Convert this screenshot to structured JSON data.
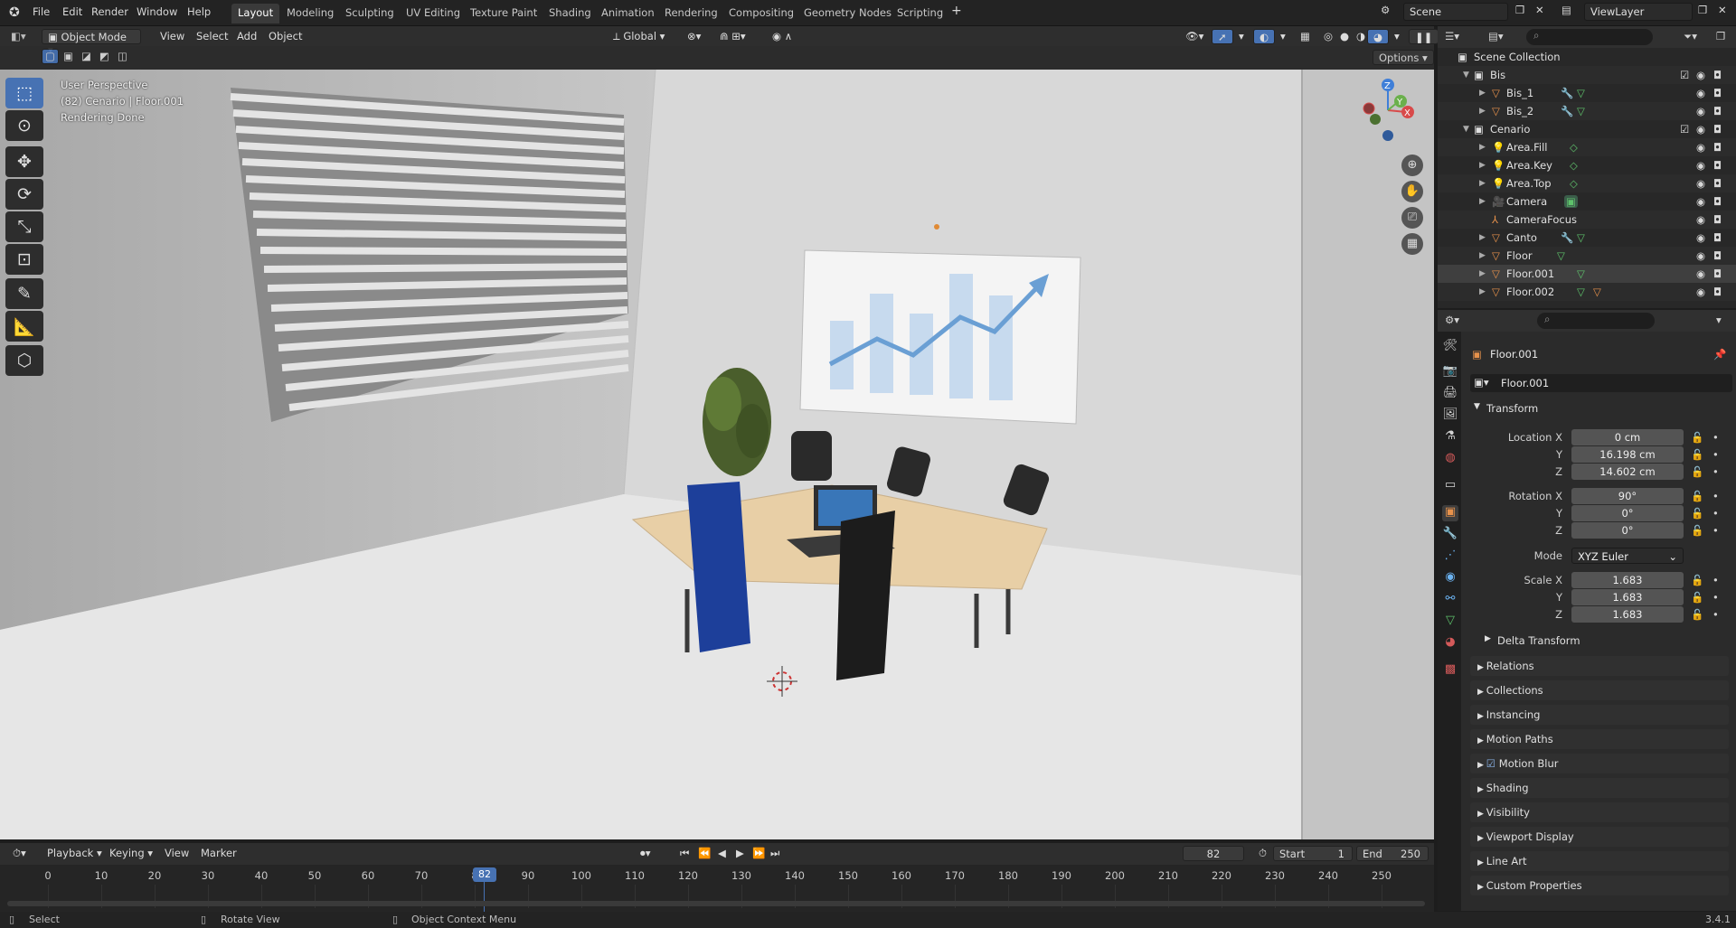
{
  "topbar": {
    "menus": [
      "File",
      "Edit",
      "Render",
      "Window",
      "Help"
    ],
    "workspaces": [
      "Layout",
      "Modeling",
      "Sculpting",
      "UV Editing",
      "Texture Paint",
      "Shading",
      "Animation",
      "Rendering",
      "Compositing",
      "Geometry Nodes",
      "Scripting"
    ],
    "active_workspace": "Layout",
    "scene": "Scene",
    "view_layer": "ViewLayer"
  },
  "viewport_header": {
    "mode": "Object Mode",
    "menus": [
      "View",
      "Select",
      "Add",
      "Object"
    ],
    "orientation": "Global",
    "options": "Options"
  },
  "viewport": {
    "perspective": "User Perspective",
    "object_info": "(82) Cenario | Floor.001",
    "render_status": "Rendering Done"
  },
  "outliner": {
    "root": "Scene Collection",
    "rows": [
      {
        "name": "Bis",
        "kind": "collection"
      },
      {
        "name": "Bis_1",
        "kind": "mesh"
      },
      {
        "name": "Bis_2",
        "kind": "mesh"
      },
      {
        "name": "Cenario",
        "kind": "collection"
      },
      {
        "name": "Area.Fill",
        "kind": "light"
      },
      {
        "name": "Area.Key",
        "kind": "light"
      },
      {
        "name": "Area.Top",
        "kind": "light"
      },
      {
        "name": "Camera",
        "kind": "camera"
      },
      {
        "name": "CameraFocus",
        "kind": "empty"
      },
      {
        "name": "Canto",
        "kind": "mesh"
      },
      {
        "name": "Floor",
        "kind": "mesh"
      },
      {
        "name": "Floor.001",
        "kind": "mesh"
      },
      {
        "name": "Floor.002",
        "kind": "mesh"
      }
    ]
  },
  "properties": {
    "object_name": "Floor.001",
    "data_name": "Floor.001",
    "transform_title": "Transform",
    "location": {
      "label": "Location X",
      "x": "0 cm",
      "y": "16.198 cm",
      "z": "14.602 cm"
    },
    "rotation": {
      "label": "Rotation X",
      "x": "90°",
      "y": "0°",
      "z": "0°"
    },
    "mode_label": "Mode",
    "mode_value": "XYZ Euler",
    "scale": {
      "label": "Scale X",
      "x": "1.683",
      "y": "1.683",
      "z": "1.683"
    },
    "axis_y": "Y",
    "axis_z": "Z",
    "delta_transform": "Delta Transform",
    "panels": [
      "Relations",
      "Collections",
      "Instancing",
      "Motion Paths",
      "Motion Blur",
      "Shading",
      "Visibility",
      "Viewport Display",
      "Line Art",
      "Custom Properties"
    ]
  },
  "timeline": {
    "menus": [
      "Playback",
      "Keying",
      "View",
      "Marker"
    ],
    "current_frame": "82",
    "start_label": "Start",
    "start": "1",
    "end_label": "End",
    "end": "250",
    "ticks": [
      "0",
      "10",
      "20",
      "30",
      "40",
      "50",
      "60",
      "70",
      "8",
      "90",
      "100",
      "110",
      "120",
      "130",
      "140",
      "150",
      "160",
      "170",
      "180",
      "190",
      "200",
      "210",
      "220",
      "230",
      "240",
      "250"
    ]
  },
  "statusbar": {
    "select": "Select",
    "rotate": "Rotate View",
    "context": "Object Context Menu",
    "version": "3.4.1"
  },
  "colors": {
    "accent": "#4772b3",
    "object": "#e6914b",
    "data": "#5ec26b"
  }
}
